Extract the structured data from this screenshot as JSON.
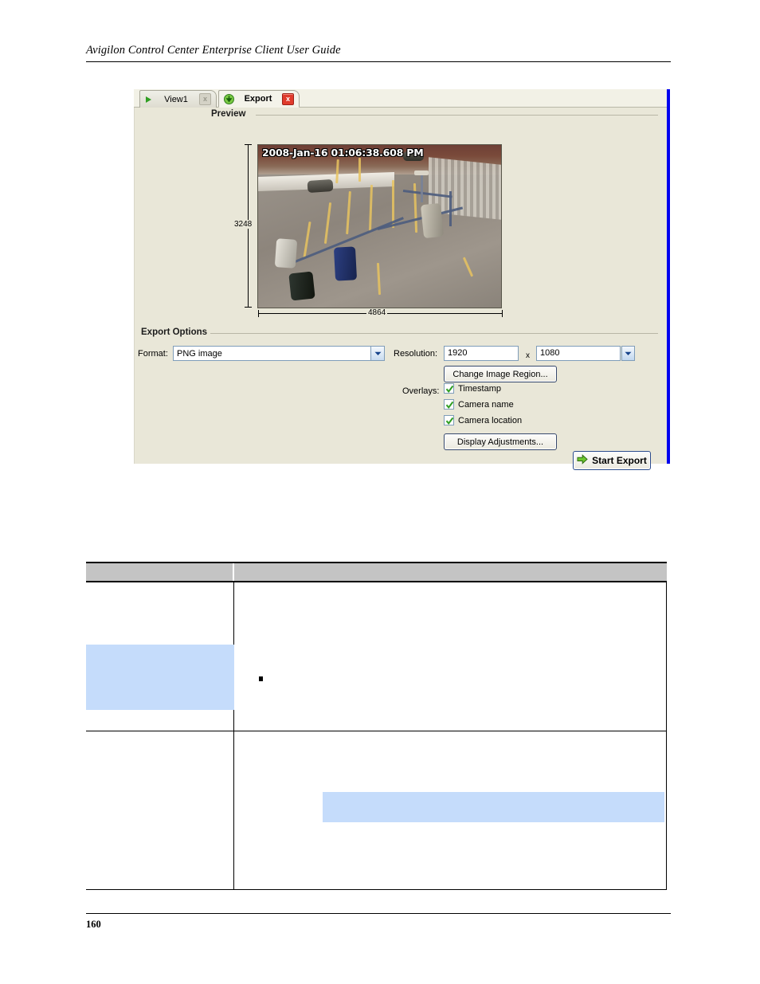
{
  "document": {
    "header_title": "Avigilon Control Center Enterprise Client User Guide",
    "page_number": "160"
  },
  "app": {
    "tabs": [
      {
        "label": "View1",
        "icon": "play-icon",
        "close_label": "x",
        "active": false
      },
      {
        "label": "Export",
        "icon": "download-arrow-icon",
        "close_label": "x",
        "active": true
      }
    ],
    "preview": {
      "group_label": "Preview",
      "timestamp_overlay": "2008-Jan-16 01:06:38.608 PM",
      "height_label": "3248",
      "width_label": "4864"
    },
    "export_options": {
      "group_label": "Export Options",
      "format_label": "Format:",
      "format_value": "PNG image",
      "resolution_label": "Resolution:",
      "resolution_width": "1920",
      "resolution_separator": "x",
      "resolution_height": "1080",
      "change_image_region_label": "Change Image Region...",
      "overlays_label": "Overlays:",
      "overlays": [
        {
          "label": "Timestamp",
          "checked": true
        },
        {
          "label": "Camera name",
          "checked": true
        },
        {
          "label": "Camera location",
          "checked": true
        }
      ],
      "display_adjustments_label": "Display Adjustments...",
      "start_export_label": "Start Export"
    },
    "colors": {
      "panel_background": "#e9e7d8",
      "panel_right_border": "#0000ee",
      "check_green": "#2f9e22",
      "close_red": "#e03b2c",
      "control_border": "#7f9db9"
    }
  },
  "table": {
    "header": {
      "col1": "",
      "col2": ""
    },
    "rows": [
      {
        "col1": "",
        "col2": ""
      },
      {
        "col1": "",
        "col2": ""
      }
    ],
    "highlight_color": "#c5dcfb"
  }
}
